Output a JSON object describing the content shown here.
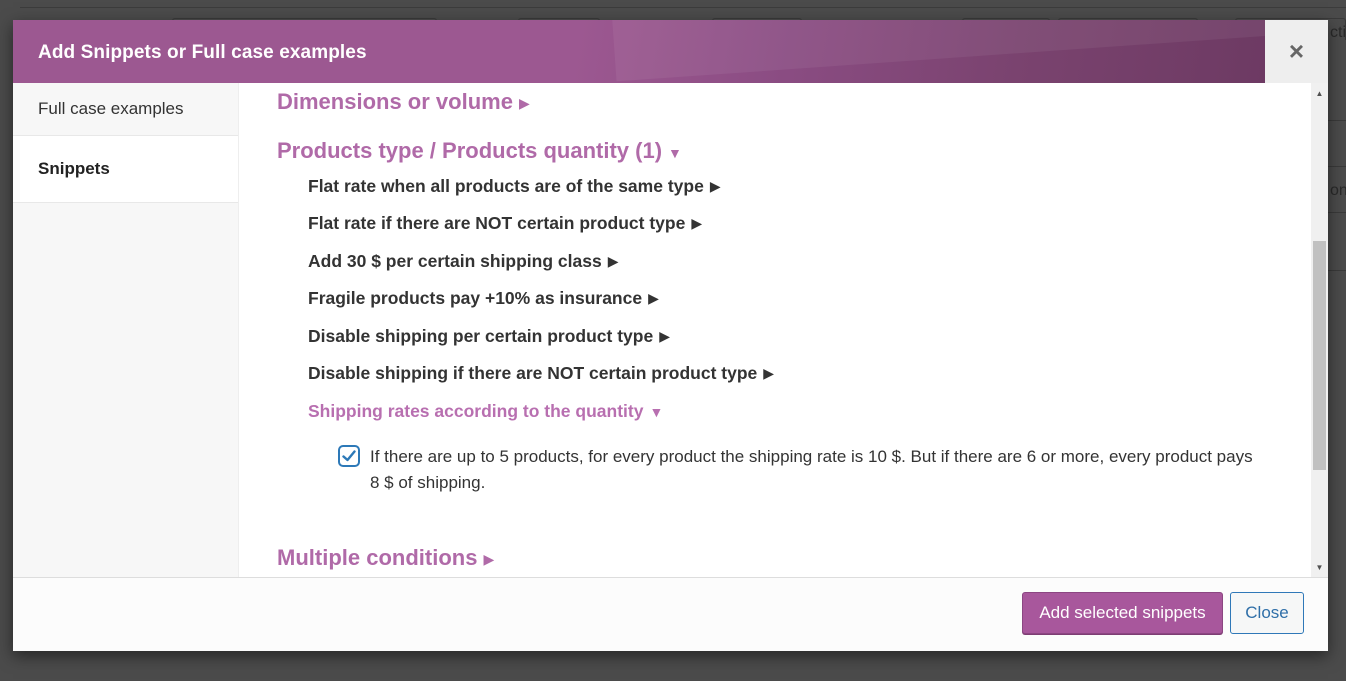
{
  "background": {
    "peek_text": "ctio",
    "peek_text_2": "ons"
  },
  "modal": {
    "title": "Add Snippets or Full case examples",
    "close_icon": "×"
  },
  "sidebar": {
    "tabs": [
      {
        "label": "Full case examples",
        "active": false
      },
      {
        "label": "Snippets",
        "active": true
      }
    ]
  },
  "content": {
    "categories": [
      {
        "label": "Dimensions or volume",
        "state": "collapsed",
        "arrow": "▶"
      },
      {
        "label": "Products type / Products quantity (1)",
        "state": "expanded",
        "arrow": "▼"
      },
      {
        "label": "Multiple conditions",
        "state": "collapsed",
        "arrow": "▶"
      }
    ],
    "subitems": [
      {
        "label": "Flat rate when all products are of the same type",
        "arrow": "▶"
      },
      {
        "label": "Flat rate if there are NOT certain product type",
        "arrow": "▶"
      },
      {
        "label": "Add 30 $ per certain shipping class",
        "arrow": "▶"
      },
      {
        "label": "Fragile products pay +10% as insurance",
        "arrow": "▶"
      },
      {
        "label": "Disable shipping per certain product type",
        "arrow": "▶"
      },
      {
        "label": "Disable shipping if there are NOT certain product type",
        "arrow": "▶"
      },
      {
        "label": "Shipping rates according to the quantity",
        "arrow": "▼",
        "open": true
      }
    ],
    "snippet": {
      "checked": true,
      "text": "If there are up to 5 products, for every product the shipping rate is 10 $. But if there are 6 or more, every product pays 8 $ of shipping."
    }
  },
  "scrollbar": {
    "up_arrow": "▲",
    "down_arrow": "▼"
  },
  "footer": {
    "primary_button": "Add selected snippets",
    "secondary_button": "Close"
  },
  "colors": {
    "brand_purple": "#9c5891",
    "category_purple": "#b06aa8",
    "primary_button": "#a8579c",
    "link_blue": "#2f78b8"
  }
}
